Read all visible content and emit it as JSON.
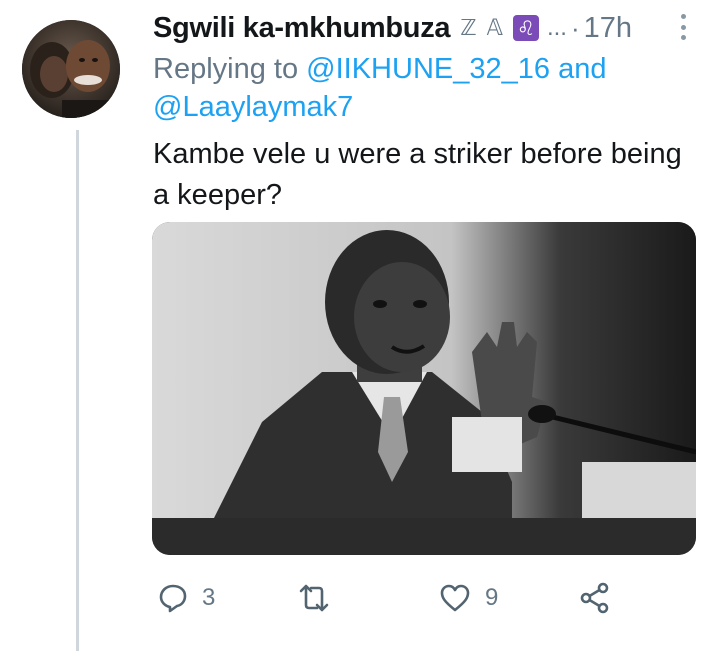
{
  "tweet": {
    "display_name": "Sgwili ka-mkhumbuza",
    "badges": [
      "ℤ",
      "𝔸"
    ],
    "zodiac_badge": "♌",
    "ellipsis": "...",
    "separator": "·",
    "time": "17h",
    "replying_prefix": "Replying to",
    "mention_1": "@IIKHUNE_32_16",
    "conjunction": "and",
    "mention_2": "@Laaylaymak7",
    "text_line_1": "Kambe vele u were a striker before being",
    "text_line_2": "a keeper?",
    "replies_count": "3",
    "likes_count": "9"
  },
  "icons": {
    "avatar": "profile-photo",
    "more": "more-vertical-icon",
    "reply": "reply-icon",
    "retweet": "retweet-icon",
    "like": "heart-icon",
    "share": "share-icon"
  },
  "colors": {
    "accent": "#1da1f2",
    "muted": "#657786",
    "text": "#14171a",
    "thread_line": "#cfd6dc"
  }
}
